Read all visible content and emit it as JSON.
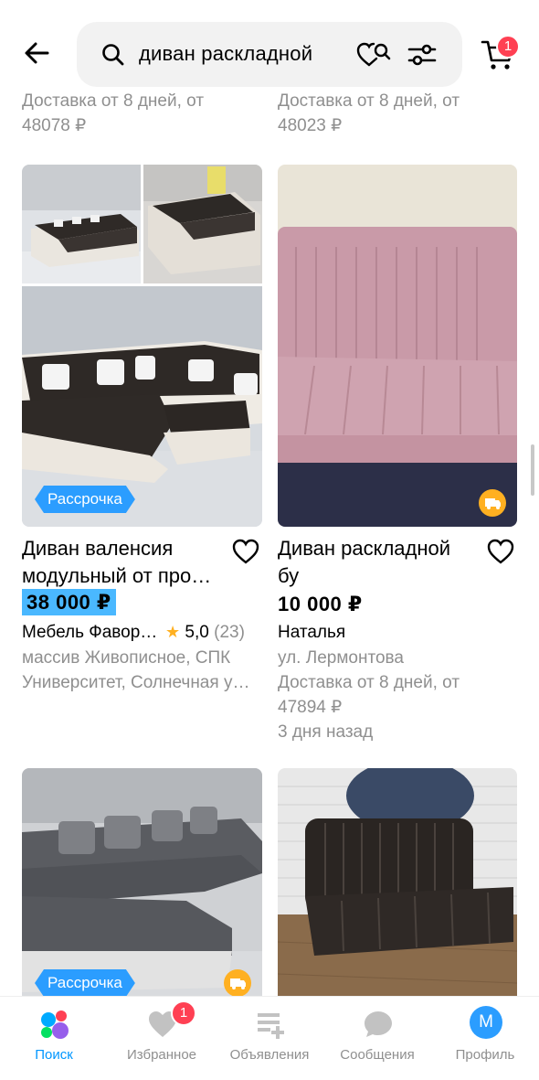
{
  "header": {
    "search_value": "диван раскладной",
    "cart_count": "1"
  },
  "top_partial": {
    "left": {
      "delivery": "Доставка от 8 дней, от",
      "price": "48078 ₽"
    },
    "right": {
      "delivery": "Доставка от 8 дней, от",
      "price": "48023 ₽"
    }
  },
  "listings": [
    {
      "title_line1": "Диван валенсия",
      "title_line2": "модульный от про…",
      "price": "38 000 ₽",
      "price_highlight": true,
      "seller": "Мебель Фавор…",
      "rating": "5,0",
      "rating_count": "(23)",
      "location_line1": "массив Живописное, СПК",
      "location_line2": "Университет, Солнечная у…",
      "badge": "Рассрочка"
    },
    {
      "title_line1": "Диван раскладной",
      "title_line2": "бу",
      "price": "10 000 ₽",
      "seller": "Наталья",
      "location_line1": "ул. Лермонтова",
      "delivery_line1": "Доставка от 8 дней, от",
      "delivery_line2": "47894 ₽",
      "posted": "3 дня назад"
    },
    {
      "badge": "Рассрочка"
    },
    {}
  ],
  "bottom_nav": [
    {
      "label": "Поиск",
      "icon": "search-tab-icon",
      "active": true
    },
    {
      "label": "Избранное",
      "icon": "heart-icon",
      "badge": "1"
    },
    {
      "label": "Объявления",
      "icon": "ads-icon"
    },
    {
      "label": "Сообщения",
      "icon": "chat-icon"
    },
    {
      "label": "Профиль",
      "icon": "avatar",
      "avatar_letter": "М"
    }
  ],
  "colors": {
    "accent": "#0096ff",
    "price_highlight": "#4ab8ff",
    "badge_red": "#ff4053",
    "installment_blue": "#2b9dff",
    "star": "#ffb021"
  }
}
